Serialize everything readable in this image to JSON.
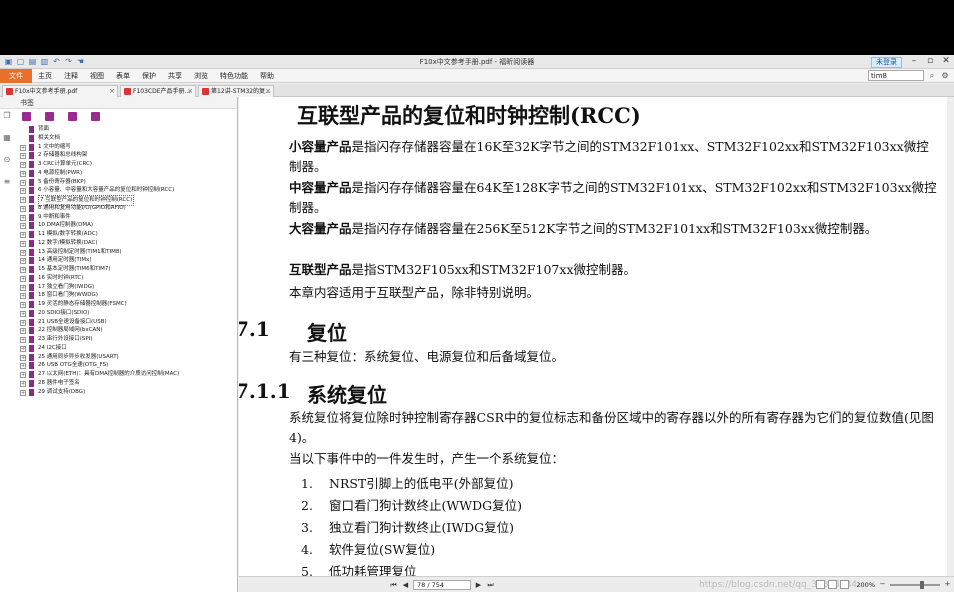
{
  "window": {
    "title": "F10x中文参考手册.pdf - 福昕阅读器",
    "login": "未登录"
  },
  "menu": {
    "file": "文件",
    "items": [
      "主页",
      "注释",
      "视图",
      "表单",
      "保护",
      "共享",
      "浏览",
      "特色功能",
      "帮助"
    ],
    "search_value": "tim8"
  },
  "tabs": [
    {
      "label": "F10x中文参考手册.pdf"
    },
    {
      "label": "F103CDE产品手册..."
    },
    {
      "label": "第12讲-STM32的复..."
    }
  ],
  "sidebar": {
    "title": "书签",
    "items": [
      {
        "label": "背面",
        "exp": false
      },
      {
        "label": "相关文档",
        "exp": false
      },
      {
        "label": "1 文中的缩写",
        "exp": true
      },
      {
        "label": "2 存储器和总线构架",
        "exp": true
      },
      {
        "label": "3 CRC计算单元(CRC)",
        "exp": true
      },
      {
        "label": "4 电源控制(PWR)",
        "exp": true
      },
      {
        "label": "5 备份寄存器(BKP)",
        "exp": true
      },
      {
        "label": "6 小容量、中容量和大容量产品的复位和时钟控制(RCC)",
        "exp": true
      },
      {
        "label": "7 互联型产品的复位和时钟控制(RCC)",
        "exp": true,
        "selected": true
      },
      {
        "label": "8 通用和复用功能I/O(GPIO和AFIO)",
        "exp": true
      },
      {
        "label": "9 中断和事件",
        "exp": true
      },
      {
        "label": "10 DMA控制器(DMA)",
        "exp": true
      },
      {
        "label": "11 模拟/数字转换(ADC)",
        "exp": true
      },
      {
        "label": "12 数字/模拟转换(DAC)",
        "exp": true
      },
      {
        "label": "13 高级控制定时器(TIM1和TIM8)",
        "exp": true
      },
      {
        "label": "14 通用定时器(TIMx)",
        "exp": true
      },
      {
        "label": "15 基本定时器(TIM6和TIM7)",
        "exp": true
      },
      {
        "label": "16 实时时钟(RTC)",
        "exp": true
      },
      {
        "label": "17 独立看门狗(IWDG)",
        "exp": true
      },
      {
        "label": "18 窗口看门狗(WWDG)",
        "exp": true
      },
      {
        "label": "19 灵活的静态存储器控制器(FSMC)",
        "exp": true
      },
      {
        "label": "20 SDIO接口(SDIO)",
        "exp": true
      },
      {
        "label": "21 USB全速设备接口(USB)",
        "exp": true
      },
      {
        "label": "22 控制器局域网(bxCAN)",
        "exp": true
      },
      {
        "label": "23 串行外设接口(SPI)",
        "exp": true
      },
      {
        "label": "24 I2C接口",
        "exp": true
      },
      {
        "label": "25 通用同步异步收发器(USART)",
        "exp": true
      },
      {
        "label": "26 USB OTG全速(OTG_FS)",
        "exp": true
      },
      {
        "label": "27 以太网(ETH)：具有DMA控制器的介质访问控制(MAC)",
        "exp": true
      },
      {
        "label": "28 器件电子签名",
        "exp": true
      },
      {
        "label": "29 调试支持(DBG)",
        "exp": true
      }
    ]
  },
  "page": {
    "title": "互联型产品的复位和时钟控制(RCC)",
    "p1_b": "小容量产品",
    "p1": "是指闪存存储器容量在16K至32K字节之间的STM32F101xx、STM32F102xx和STM32F103xx微控制器。",
    "p2_b": "中容量产品",
    "p2": "是指闪存存储器容量在64K至128K字节之间的STM32F101xx、STM32F102xx和STM32F103xx微控制器。",
    "p3_b": "大容量产品",
    "p3": "是指闪存存储器容量在256K至512K字节之间的STM32F101xx和STM32F103xx微控制器。",
    "p4_b": "互联型产品",
    "p4": "是指STM32F105xx和STM32F107xx微控制器。",
    "p5": "本章内容适用于互联型产品，除非特别说明。",
    "s1_num": "7.1",
    "s1_title": "复位",
    "s1_text": "有三种复位：系统复位、电源复位和后备域复位。",
    "s2_num": "7.1.1",
    "s2_title": "系统复位",
    "s2_text": "系统复位将复位除时钟控制寄存器CSR中的复位标志和备份区域中的寄存器以外的所有寄存器为它们的复位数值(见图4)。",
    "s2_intro": "当以下事件中的一件发生时，产生一个系统复位：",
    "list": [
      {
        "n": "1.",
        "t": "NRST引脚上的低电平(外部复位)"
      },
      {
        "n": "2.",
        "t": "窗口看门狗计数终止(WWDG复位)"
      },
      {
        "n": "3.",
        "t": "独立看门狗计数终止(IWDG复位)"
      },
      {
        "n": "4.",
        "t": "软件复位(SW复位)"
      },
      {
        "n": "5.",
        "t": "低功耗管理复位"
      }
    ]
  },
  "status": {
    "page": "78 / 754",
    "zoom": "200%",
    "watermark": "https://blog.csdn.net/qq_34845534"
  }
}
